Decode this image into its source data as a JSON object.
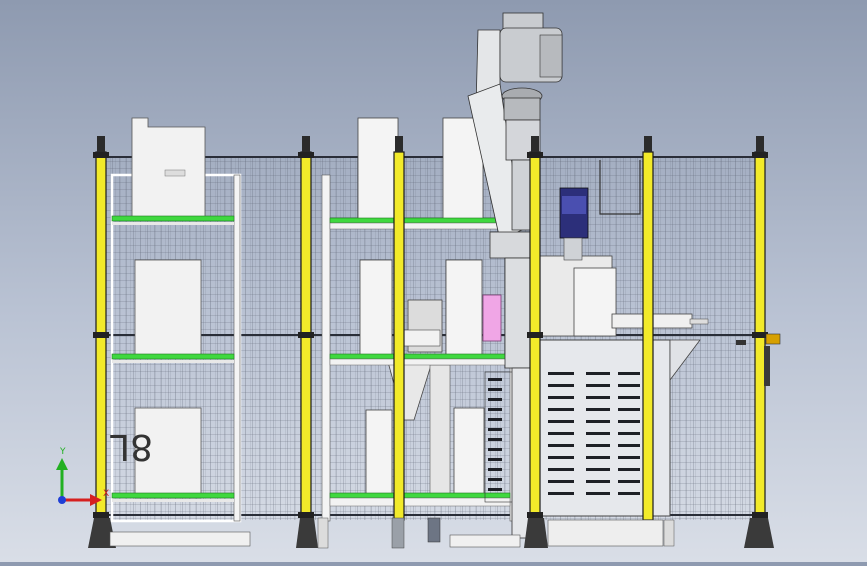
{
  "viewport": {
    "part_label": "8L",
    "axis": {
      "y_label": "Y",
      "x_label": "X"
    }
  },
  "colors": {
    "background_top": "#8e9ab0",
    "background_bottom": "#d9dee7",
    "post_yellow": "#f2ea2a",
    "shelf_green": "#3fd83f",
    "robot_gray": "#c9ccd0",
    "motor_blue": "#2c2f7a",
    "pink_block": "#f0a6e6"
  },
  "icons": {
    "triad": "axis-triad-icon"
  }
}
